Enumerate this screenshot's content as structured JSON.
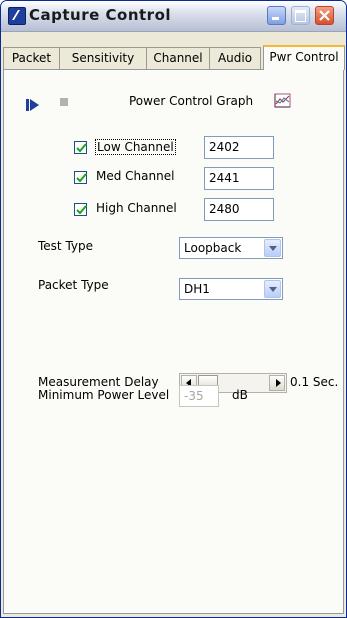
{
  "window": {
    "title": "Capture Control"
  },
  "tabs": [
    {
      "label": "Packet"
    },
    {
      "label": "Sensitivity"
    },
    {
      "label": "Channel"
    },
    {
      "label": "Audio"
    },
    {
      "label": "Pwr Control",
      "active": true
    }
  ],
  "toolbar": {
    "graph_label": "Power Control Graph"
  },
  "channels": [
    {
      "label": "Low Channel",
      "checked": true,
      "value": "2402"
    },
    {
      "label": "Med Channel",
      "checked": true,
      "value": "2441"
    },
    {
      "label": "High Channel",
      "checked": true,
      "value": "2480"
    }
  ],
  "test_type": {
    "label": "Test Type",
    "value": "Loopback"
  },
  "packet_type": {
    "label": "Packet Type",
    "value": "DH1"
  },
  "measurement_delay": {
    "label": "Measurement Delay",
    "value_label": "0.1 Sec.",
    "level_fraction": 0
  },
  "min_power": {
    "label": "Minimum Power Level",
    "value": "-35",
    "unit": "dB"
  },
  "colors": {
    "title_bar": "#c8cfdf",
    "active_tab_accent": "#f7b83a",
    "play_icon": "#1f3f9f",
    "panel": "#fbfbf7"
  }
}
